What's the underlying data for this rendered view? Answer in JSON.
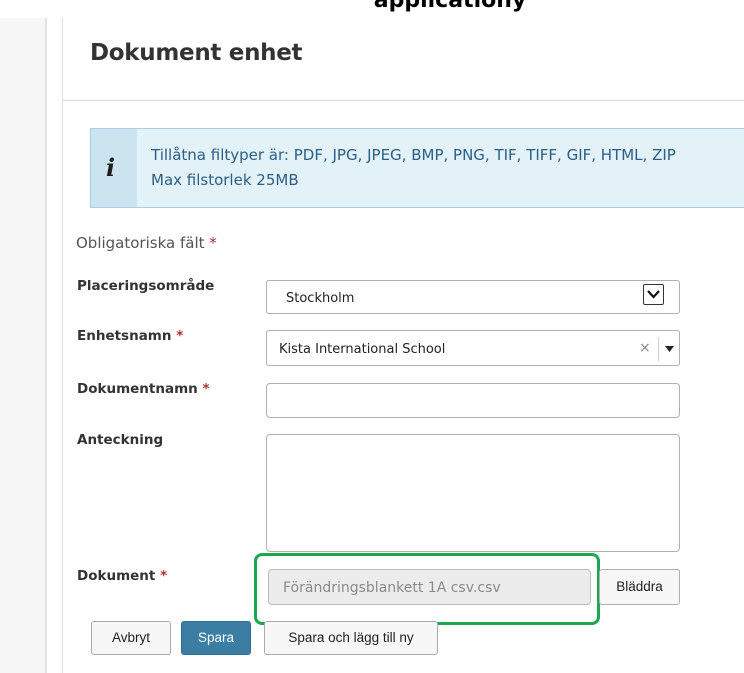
{
  "caption": "applicationy",
  "page": {
    "title": "Dokument enhet"
  },
  "info": {
    "icon": "info-icon",
    "symbol": "i",
    "line1": "Tillåtna filtyper är: PDF, JPG, JPEG, BMP, PNG, TIF, TIFF, GIF, HTML, ZIP",
    "line2": "Max filstorlek 25MB"
  },
  "form": {
    "required_note": "Obligatoriska fält",
    "asterisk": "*",
    "placement": {
      "label": "Placeringsområde",
      "value": "Stockholm"
    },
    "unit": {
      "label": "Enhetsnamn",
      "value": "Kista International School",
      "clear_symbol": "×"
    },
    "document_name": {
      "label": "Dokumentnamn",
      "value": ""
    },
    "note": {
      "label": "Anteckning",
      "value": ""
    },
    "document": {
      "label": "Dokument",
      "value": "Förändringsblankett 1A csv.csv",
      "browse_label": "Bläddra"
    }
  },
  "actions": {
    "cancel_label": "Avbryt",
    "save_label": "Spara",
    "save_new_label": "Spara och lägg till ny"
  },
  "colors": {
    "highlight": "#1aa84e",
    "primary": "#3c7ea3",
    "info_background": "#e3f1f8",
    "required": "#b03030"
  }
}
